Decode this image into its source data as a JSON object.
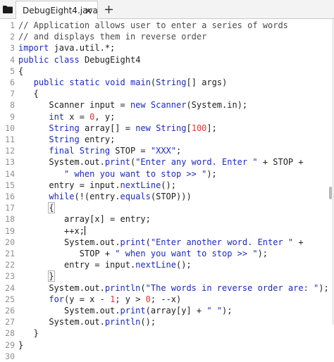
{
  "tab": {
    "title": "DebugEight4.java"
  },
  "icons": {
    "folder": "folder-icon",
    "close": "close-icon",
    "add": "plus-icon"
  },
  "colors": {
    "keyword": "#1c2bb8",
    "number": "#e3342f",
    "comment": "#4b4b4b",
    "text": "#202020",
    "line_number": "#8f8f8f"
  },
  "editor": {
    "lines": [
      {
        "n": "1",
        "tokens": [
          {
            "t": "// Application allows user to enter a series of words",
            "c": "comment"
          }
        ]
      },
      {
        "n": "2",
        "tokens": [
          {
            "t": "// and displays them in reverse order",
            "c": "comment"
          }
        ]
      },
      {
        "n": "3",
        "tokens": [
          {
            "t": "import",
            "c": "keyword"
          },
          {
            "t": " java.util.*;",
            "c": "plain"
          }
        ]
      },
      {
        "n": "4",
        "tokens": [
          {
            "t": "public",
            "c": "keyword"
          },
          {
            "t": " ",
            "c": "plain"
          },
          {
            "t": "class",
            "c": "keyword"
          },
          {
            "t": " DebugEight4",
            "c": "plain"
          }
        ]
      },
      {
        "n": "5",
        "tokens": [
          {
            "t": "{",
            "c": "plain"
          }
        ]
      },
      {
        "n": "6",
        "tokens": [
          {
            "t": "   ",
            "c": "plain"
          },
          {
            "t": "public",
            "c": "keyword"
          },
          {
            "t": " ",
            "c": "plain"
          },
          {
            "t": "static",
            "c": "keyword"
          },
          {
            "t": " ",
            "c": "plain"
          },
          {
            "t": "void",
            "c": "keyword"
          },
          {
            "t": " ",
            "c": "plain"
          },
          {
            "t": "main",
            "c": "method"
          },
          {
            "t": "(",
            "c": "plain"
          },
          {
            "t": "String",
            "c": "type"
          },
          {
            "t": "[] args)",
            "c": "plain"
          }
        ]
      },
      {
        "n": "7",
        "tokens": [
          {
            "t": "   {",
            "c": "plain"
          }
        ]
      },
      {
        "n": "8",
        "tokens": [
          {
            "t": "      Scanner input = ",
            "c": "plain"
          },
          {
            "t": "new",
            "c": "keyword"
          },
          {
            "t": " ",
            "c": "plain"
          },
          {
            "t": "Scanner",
            "c": "type"
          },
          {
            "t": "(System.in);",
            "c": "plain"
          }
        ]
      },
      {
        "n": "9",
        "tokens": [
          {
            "t": "      ",
            "c": "plain"
          },
          {
            "t": "int",
            "c": "keyword"
          },
          {
            "t": " x = ",
            "c": "plain"
          },
          {
            "t": "0",
            "c": "number"
          },
          {
            "t": ", y;",
            "c": "plain"
          }
        ]
      },
      {
        "n": "10",
        "tokens": [
          {
            "t": "      ",
            "c": "plain"
          },
          {
            "t": "String",
            "c": "type"
          },
          {
            "t": " array[] = ",
            "c": "plain"
          },
          {
            "t": "new",
            "c": "keyword"
          },
          {
            "t": " ",
            "c": "plain"
          },
          {
            "t": "String",
            "c": "type"
          },
          {
            "t": "[",
            "c": "plain"
          },
          {
            "t": "100",
            "c": "number"
          },
          {
            "t": "];",
            "c": "plain"
          }
        ]
      },
      {
        "n": "11",
        "tokens": [
          {
            "t": "      ",
            "c": "plain"
          },
          {
            "t": "String",
            "c": "type"
          },
          {
            "t": " entry;",
            "c": "plain"
          }
        ]
      },
      {
        "n": "12",
        "tokens": [
          {
            "t": "      ",
            "c": "plain"
          },
          {
            "t": "final",
            "c": "keyword"
          },
          {
            "t": " ",
            "c": "plain"
          },
          {
            "t": "String",
            "c": "type"
          },
          {
            "t": " STOP = ",
            "c": "plain"
          },
          {
            "t": "\"XXX\"",
            "c": "string"
          },
          {
            "t": ";",
            "c": "plain"
          }
        ]
      },
      {
        "n": "13",
        "tokens": [
          {
            "t": "      System.out.",
            "c": "plain"
          },
          {
            "t": "print",
            "c": "method"
          },
          {
            "t": "(",
            "c": "plain"
          },
          {
            "t": "\"Enter any word. Enter \"",
            "c": "string"
          },
          {
            "t": " + STOP +",
            "c": "plain"
          }
        ]
      },
      {
        "n": "14",
        "tokens": [
          {
            "t": "         ",
            "c": "plain"
          },
          {
            "t": "\" when you want to stop >> \"",
            "c": "string"
          },
          {
            "t": ");",
            "c": "plain"
          }
        ]
      },
      {
        "n": "15",
        "tokens": [
          {
            "t": "      entry = input.",
            "c": "plain"
          },
          {
            "t": "nextLine",
            "c": "method"
          },
          {
            "t": "();",
            "c": "plain"
          }
        ]
      },
      {
        "n": "16",
        "tokens": [
          {
            "t": "      ",
            "c": "plain"
          },
          {
            "t": "while",
            "c": "keyword"
          },
          {
            "t": "(!(entry.",
            "c": "plain"
          },
          {
            "t": "equals",
            "c": "method"
          },
          {
            "t": "(STOP)))",
            "c": "plain"
          }
        ]
      },
      {
        "n": "17",
        "tokens": [
          {
            "t": "      ",
            "c": "plain"
          },
          {
            "t": "{",
            "c": "bracket"
          }
        ]
      },
      {
        "n": "18",
        "tokens": [
          {
            "t": "         array[x] = entry;",
            "c": "plain"
          }
        ]
      },
      {
        "n": "19",
        "tokens": [
          {
            "t": "         ++x;",
            "c": "plain"
          },
          {
            "t": "",
            "c": "cursor"
          }
        ]
      },
      {
        "n": "20",
        "tokens": [
          {
            "t": "         System.out.",
            "c": "plain"
          },
          {
            "t": "print",
            "c": "method"
          },
          {
            "t": "(",
            "c": "plain"
          },
          {
            "t": "\"Enter another word. Enter \"",
            "c": "string"
          },
          {
            "t": " +",
            "c": "plain"
          }
        ]
      },
      {
        "n": "21",
        "tokens": [
          {
            "t": "            STOP + ",
            "c": "plain"
          },
          {
            "t": "\" when you want to stop >> \"",
            "c": "string"
          },
          {
            "t": ");",
            "c": "plain"
          }
        ]
      },
      {
        "n": "22",
        "tokens": [
          {
            "t": "         entry = input.",
            "c": "plain"
          },
          {
            "t": "nextLine",
            "c": "method"
          },
          {
            "t": "();",
            "c": "plain"
          }
        ]
      },
      {
        "n": "23",
        "tokens": [
          {
            "t": "      ",
            "c": "plain"
          },
          {
            "t": "}",
            "c": "bracket"
          }
        ]
      },
      {
        "n": "24",
        "tokens": [
          {
            "t": "      System.out.",
            "c": "plain"
          },
          {
            "t": "println",
            "c": "method"
          },
          {
            "t": "(",
            "c": "plain"
          },
          {
            "t": "\"The words in reverse order are: \"",
            "c": "string"
          },
          {
            "t": ");",
            "c": "plain"
          }
        ]
      },
      {
        "n": "25",
        "tokens": [
          {
            "t": "      ",
            "c": "plain"
          },
          {
            "t": "for",
            "c": "keyword"
          },
          {
            "t": "(y = x - ",
            "c": "plain"
          },
          {
            "t": "1",
            "c": "number"
          },
          {
            "t": "; y > ",
            "c": "plain"
          },
          {
            "t": "0",
            "c": "number"
          },
          {
            "t": "; --x)",
            "c": "plain"
          }
        ]
      },
      {
        "n": "26",
        "tokens": [
          {
            "t": "         System.out.",
            "c": "plain"
          },
          {
            "t": "print",
            "c": "method"
          },
          {
            "t": "(array[y] + ",
            "c": "plain"
          },
          {
            "t": "\" \"",
            "c": "string"
          },
          {
            "t": ");",
            "c": "plain"
          }
        ]
      },
      {
        "n": "27",
        "tokens": [
          {
            "t": "      System.out.",
            "c": "plain"
          },
          {
            "t": "println",
            "c": "method"
          },
          {
            "t": "();",
            "c": "plain"
          }
        ]
      },
      {
        "n": "28",
        "tokens": [
          {
            "t": "   }",
            "c": "plain"
          }
        ]
      },
      {
        "n": "29",
        "tokens": [
          {
            "t": "}",
            "c": "plain"
          }
        ]
      },
      {
        "n": "30",
        "tokens": []
      }
    ]
  }
}
